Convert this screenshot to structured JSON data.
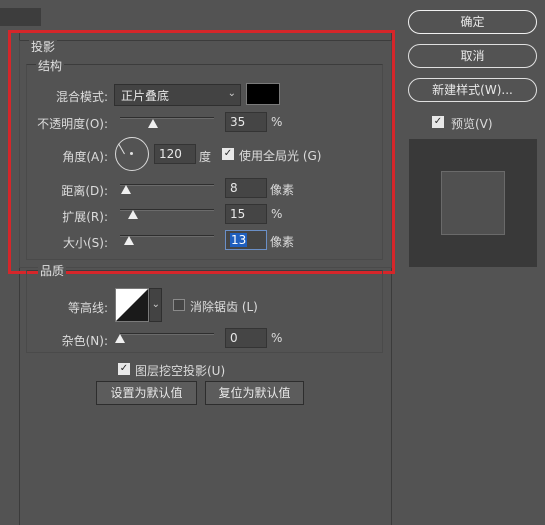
{
  "dialog": {
    "section_shadow": "投影",
    "structure": {
      "title": "结构",
      "blend_mode_label": "混合模式:",
      "blend_mode_value": "正片叠底",
      "opacity_label": "不透明度(O):",
      "opacity_value": "35",
      "opacity_unit": "%",
      "opacity_fraction": 0.35,
      "angle_label": "角度(A):",
      "angle_value": "120",
      "angle_unit": "度",
      "global_light_label": "使用全局光 (G)",
      "global_light_checked": true,
      "distance_label": "距离(D):",
      "distance_value": "8",
      "distance_unit": "像素",
      "spread_label": "扩展(R):",
      "spread_value": "15",
      "spread_unit": "%",
      "size_label": "大小(S):",
      "size_value": "13",
      "size_unit": "像素",
      "color": "#000000"
    },
    "quality": {
      "title": "品质",
      "contour_label": "等高线:",
      "anti_alias_label": "消除锯齿 (L)",
      "anti_alias_checked": false,
      "noise_label": "杂色(N):",
      "noise_value": "0",
      "noise_unit": "%"
    },
    "knockout_label": "图层挖空投影(U)",
    "knockout_checked": true,
    "set_default_label": "设置为默认值",
    "reset_default_label": "复位为默认值"
  },
  "sidebar": {
    "ok_label": "确定",
    "cancel_label": "取消",
    "new_style_label": "新建样式(W)...",
    "preview_label": "预览(V)",
    "preview_checked": true
  },
  "colors": {
    "highlight_border": "#d6262a",
    "selection": "#1f5fbf"
  }
}
